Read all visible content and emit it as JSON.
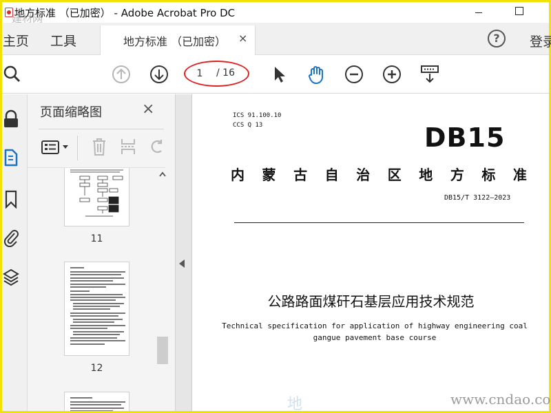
{
  "window": {
    "title": "地方标准 （已加密） - Adobe Acrobat Pro DC",
    "watermark_top": "建材网"
  },
  "tabs": {
    "home": "主页",
    "tools": "工具",
    "document": "地方标准 （已加密）",
    "close": "×",
    "help": "?",
    "login": "登录"
  },
  "toolbar": {
    "current_page": "1",
    "total_pages": "/ 16",
    "icons": [
      "search-icon",
      "page-up-icon",
      "page-down-icon",
      "select-arrow-icon",
      "hand-tool-icon",
      "zoom-out-icon",
      "zoom-in-icon",
      "scroll-mode-icon"
    ]
  },
  "rail": {
    "icons": [
      "lock-icon",
      "pages-icon",
      "bookmark-icon",
      "attachment-icon",
      "layers-icon"
    ]
  },
  "thumbnail_panel": {
    "title": "页面缩略图",
    "close": "×",
    "pages": [
      {
        "number": "11"
      },
      {
        "number": "12"
      }
    ]
  },
  "document": {
    "ics_line": "ICS  91.100.10",
    "ccs_line": "CCS  Q 13",
    "logo": "DB15",
    "standard_name_chars": [
      "内",
      "蒙",
      "古",
      "自",
      "治",
      "区",
      "地",
      "方",
      "标",
      "准"
    ],
    "standard_number": "DB15/T 3122—2023",
    "title_cn": "公路路面煤矸石基层应用技术规范",
    "title_en_line1": "Technical specification for application of highway engineering coal",
    "title_en_line2": "gangue pavement base course",
    "watermark_page": "地",
    "watermark_bottom": "www.cndao.com"
  },
  "colors": {
    "frame": "#f2e200",
    "annotation": "#e02020",
    "accent_blue": "#1a73c8"
  }
}
